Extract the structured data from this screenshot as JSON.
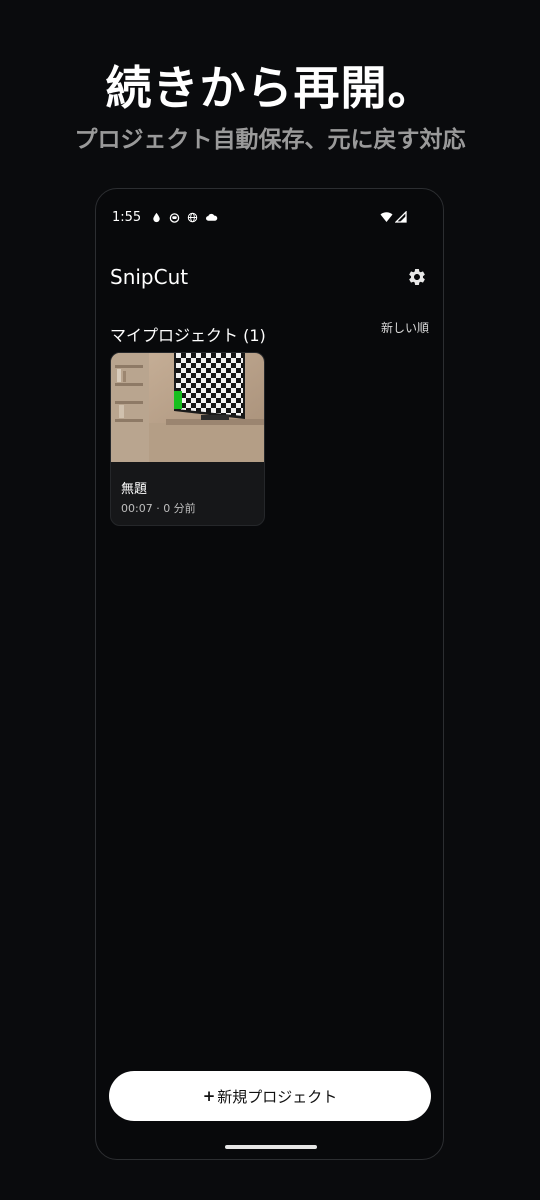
{
  "promo": {
    "title": "続きから再開。",
    "subtitle": "プロジェクト自動保存、元に戻す対応"
  },
  "status_bar": {
    "time": "1:55",
    "left_icons": [
      "drop-icon",
      "face-icon",
      "globe-icon",
      "cloud-icon"
    ],
    "right_icons": [
      "wifi-icon",
      "signal-icon"
    ]
  },
  "header": {
    "app_title": "SnipCut",
    "settings_icon": "gear-icon"
  },
  "projects_section": {
    "title": "マイプロジェクト (1)",
    "sort_label": "新しい順",
    "items": [
      {
        "name": "無題",
        "meta": "00:07 · 0 分前",
        "thumbnail_icon": "video-thumbnail"
      }
    ]
  },
  "new_project_button": {
    "plus": "+",
    "label": "新規プロジェクト"
  },
  "colors": {
    "background": "#0a0b0d",
    "button_bg": "#ffffff",
    "subtitle": "#9a9a9a",
    "card_bg": "#161719"
  }
}
